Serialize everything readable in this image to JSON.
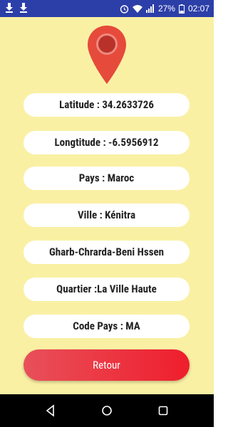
{
  "status": {
    "battery": "27%",
    "time": "02:07"
  },
  "info": {
    "latitude": "Latitude : 34.2633726",
    "longitude": "Longtitude : -6.5956912",
    "country": "Pays : Maroc",
    "city": "Ville : Kénitra",
    "region": "Gharb-Chrarda-Beni Hssen",
    "district": "Quartier :La Ville Haute",
    "country_code": "Code Pays : MA"
  },
  "back_label": "Retour",
  "colors": {
    "status_bar": "#2c3fa8",
    "background": "#faf0a4",
    "accent": "#ef1e2c",
    "pin": "#e64a3b"
  }
}
